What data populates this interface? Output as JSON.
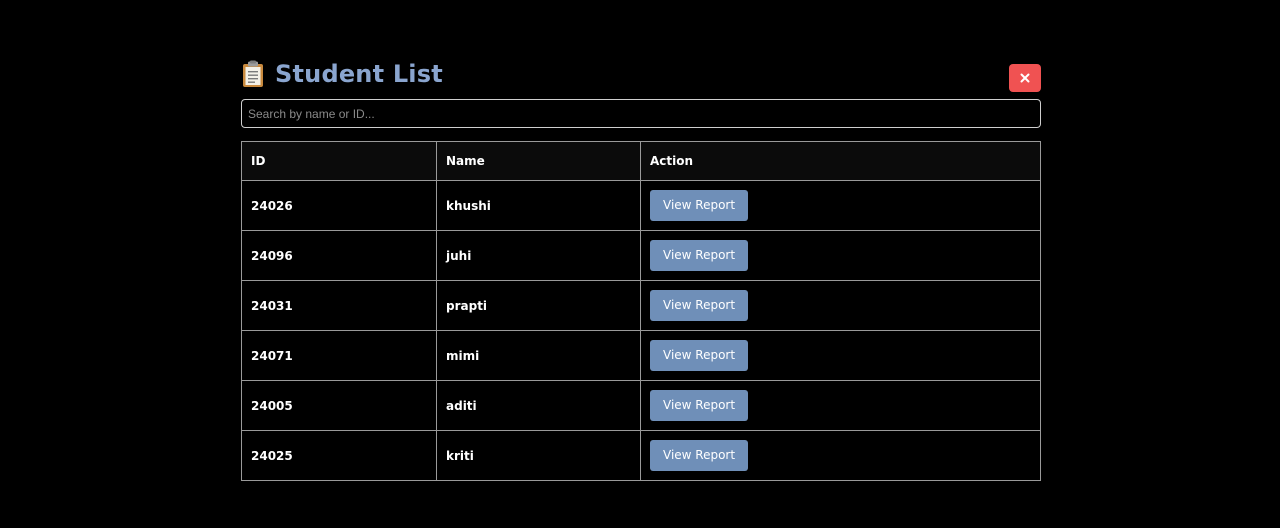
{
  "header": {
    "title": "Student List",
    "icon": "clipboard-icon",
    "close_icon": "close-icon",
    "title_color": "#8aa5cf",
    "close_color": "#f05252"
  },
  "search": {
    "placeholder": "Search by name or ID..."
  },
  "table": {
    "columns": [
      "ID",
      "Name",
      "Action"
    ],
    "rows": [
      {
        "id": "24026",
        "name": "khushi",
        "action": "View Report"
      },
      {
        "id": "24096",
        "name": "juhi",
        "action": "View Report"
      },
      {
        "id": "24031",
        "name": "prapti",
        "action": "View Report"
      },
      {
        "id": "24071",
        "name": "mimi",
        "action": "View Report"
      },
      {
        "id": "24005",
        "name": "aditi",
        "action": "View Report"
      },
      {
        "id": "24025",
        "name": "kriti",
        "action": "View Report"
      }
    ],
    "button_color": "#6f8fb8"
  }
}
